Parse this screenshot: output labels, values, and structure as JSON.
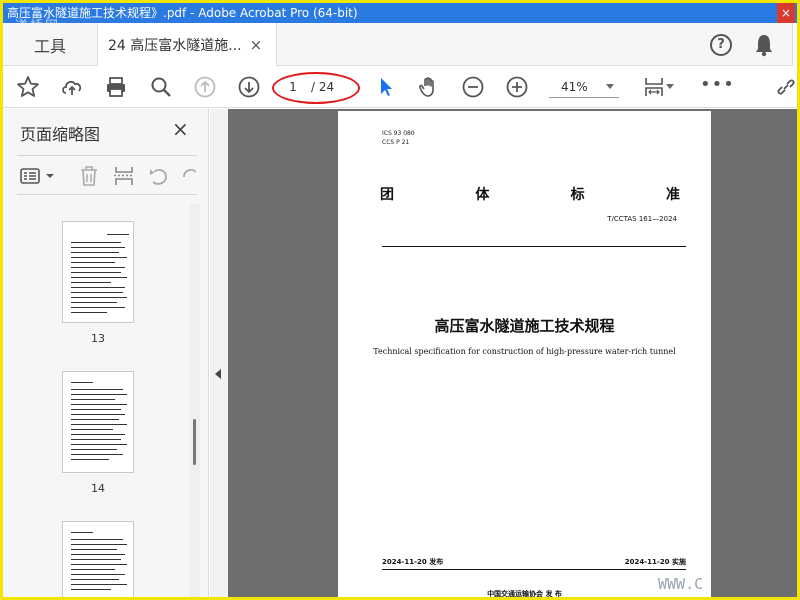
{
  "window": {
    "title": "高压富水隧道施工技术规程》.pdf - Adobe Acrobat Pro (64-bit)",
    "close_glyph": "×",
    "watermark_top": "道桥网",
    "watermark_bottom": "WWW.C"
  },
  "tabs": {
    "tools_label": "工具",
    "doc_label": "24 高压富水隧道施...",
    "doc_close": "×",
    "help_glyph": "?"
  },
  "toolbar": {
    "current_page": "1",
    "total_pages": "/ 24",
    "zoom": "41%",
    "more_glyph": "•••",
    "icons": [
      "star-icon",
      "upload-icon",
      "print-icon",
      "zoom-search-icon",
      "page-up-icon",
      "page-down-icon",
      "select-arrow-icon",
      "hand-icon",
      "zoom-out-icon",
      "zoom-in-icon",
      "fit-page-icon",
      "link-icon"
    ]
  },
  "sidebar": {
    "title": "页面缩略图",
    "close_glyph": "×",
    "thumbnails": [
      {
        "label": "13"
      },
      {
        "label": "14"
      },
      {
        "label": ""
      }
    ]
  },
  "document": {
    "ics": "ICS  93 080",
    "ccs": "CCS  P 21",
    "standard_chars": [
      "团",
      "体",
      "标",
      "准"
    ],
    "code": "T/CCTAS 161—2024",
    "title": "高压富水隧道施工技术规程",
    "subtitle": "Technical specification for construction of high-pressure water-rich tunnel",
    "published": "2024-11-20 发布",
    "effective": "2024-11-20 实施",
    "publisher": "中国交通运输协会    发 布"
  },
  "colors": {
    "titlebar": "#2a7ae2",
    "frame": "#f2e600",
    "highlight_oval": "#e11b1b",
    "select_tool_active": "#1a73e8"
  }
}
